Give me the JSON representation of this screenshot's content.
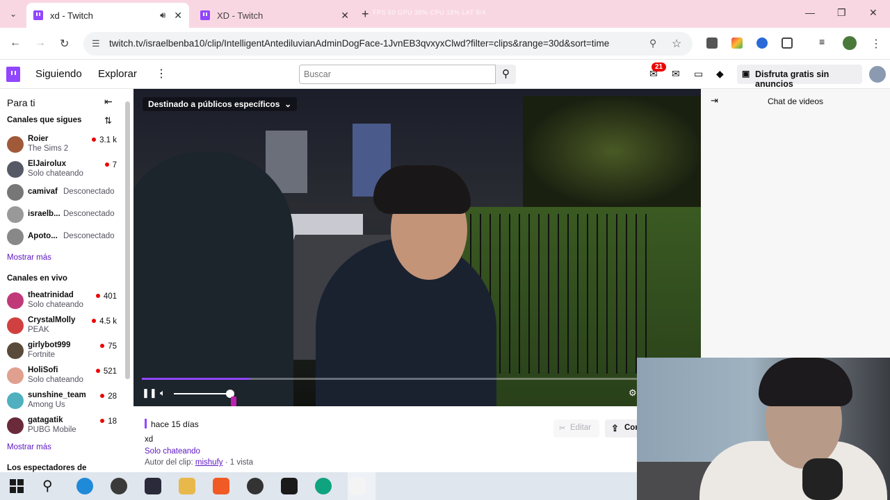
{
  "browser": {
    "tabs": [
      {
        "title": "xd - Twitch",
        "active": true
      },
      {
        "title": "XD - Twitch",
        "active": false
      }
    ],
    "perf_overlay": "FPS 60  GPU 38%  CPU 18%  LAT 8/4",
    "url": "twitch.tv/israelbenba10/clip/IntelligentAntediluvianAdminDogFace-1JvnEB3qvxyxClwd?filter=clips&range=30d&sort=time"
  },
  "twitch_nav": {
    "following": "Siguiendo",
    "browse": "Explorar",
    "search_placeholder": "Buscar",
    "notifications_count": "21",
    "ad_free": "Disfruta gratis sin anuncios"
  },
  "sidebar": {
    "title": "Para ti",
    "followed_header": "Canales que sigues",
    "followed": [
      {
        "name": "Roier",
        "game": "The Sims 2",
        "viewers": "3.1 k",
        "color": "#a05a3a"
      },
      {
        "name": "ElJairolux",
        "game": "Solo chateando",
        "viewers": "7",
        "color": "#555a66"
      },
      {
        "name": "camivaf",
        "status": "Desconectado",
        "color": "#777"
      },
      {
        "name": "israelb...",
        "status": "Desconectado",
        "color": "#999"
      },
      {
        "name": "Apoto...",
        "status": "Desconectado",
        "color": "#888"
      }
    ],
    "show_more": "Mostrar más",
    "live_header": "Canales en vivo",
    "live": [
      {
        "name": "theatrinidad",
        "game": "Solo chateando",
        "viewers": "401",
        "color": "#c03a7a"
      },
      {
        "name": "CrystalMolly",
        "game": "PEAK",
        "viewers": "4.5 k",
        "color": "#d04040"
      },
      {
        "name": "girlybot999",
        "game": "Fortnite",
        "viewers": "75",
        "color": "#5a4a3a"
      },
      {
        "name": "HoliSofi",
        "game": "Solo chateando",
        "viewers": "521",
        "color": "#e0a090"
      },
      {
        "name": "sunshine_team",
        "game": "Among Us",
        "viewers": "28",
        "color": "#50b0c0"
      },
      {
        "name": "gatagatik",
        "game": "PUBG Mobile",
        "viewers": "18",
        "color": "#6a2a3a"
      }
    ],
    "show_more_2": "Mostrar más",
    "viewers_header": "Los espectadores de"
  },
  "player": {
    "audience_label": "Destinado a públicos específicos",
    "progress_fraction": 0.195,
    "volume_fraction": 0.96
  },
  "chat": {
    "title": "Chat de videos"
  },
  "clip": {
    "age": "hace 15 días",
    "title": "xd",
    "category": "Solo chateando",
    "author_prefix": "Autor del clip:",
    "author": "mishufy",
    "views": " · 1 vista",
    "edit_label": "Editar",
    "share_label": "Compartir"
  },
  "taskbar": {
    "apps": [
      {
        "name": "edge-icon",
        "color": "#1f8ad8"
      },
      {
        "name": "obs-icon",
        "color": "#3a3a3a"
      },
      {
        "name": "react-icon",
        "color": "#2a2a3a"
      },
      {
        "name": "folder-icon",
        "color": "#e8b84a"
      },
      {
        "name": "brave-icon",
        "color": "#f15a24"
      },
      {
        "name": "record-icon",
        "color": "#333"
      },
      {
        "name": "capcut-icon",
        "color": "#1a1a1a"
      },
      {
        "name": "chatgpt-icon",
        "color": "#10a37f"
      },
      {
        "name": "paint-icon",
        "color": "#f4f4f4"
      }
    ]
  }
}
